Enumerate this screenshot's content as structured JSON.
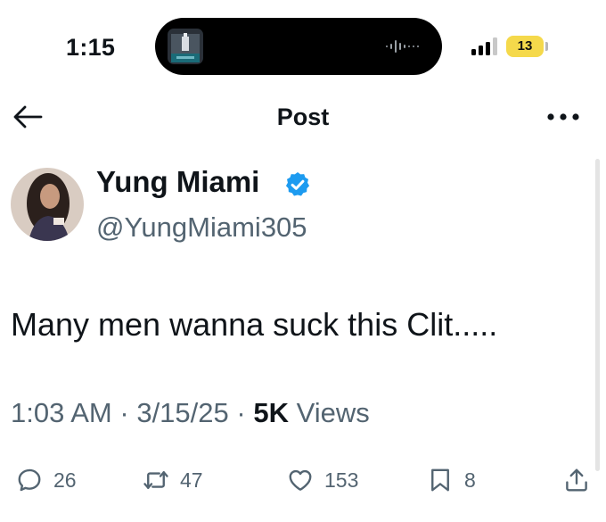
{
  "status_bar": {
    "time": "1:15",
    "battery": "13",
    "icons": [
      "now-playing-artwork",
      "audio-waveform-icon",
      "cellular-signal-icon",
      "battery-icon"
    ]
  },
  "header": {
    "title": "Post",
    "back_icon": "arrow-left-icon",
    "more_icon": "more-horizontal-icon"
  },
  "tweet": {
    "author_name": "Yung Miami",
    "author_handle": "@YungMiami305",
    "verified": true,
    "verified_color": "#1d9bf0",
    "text": "Many men wanna suck this Clit.....",
    "time": "1:03 AM",
    "date": "3/15/25",
    "separator": "·",
    "views_count": "5K",
    "views_label": "Views"
  },
  "actions": {
    "replies": "26",
    "reposts": "47",
    "likes": "153",
    "bookmarks": "8"
  },
  "colors": {
    "text_primary": "#0f1419",
    "text_secondary": "#536471",
    "accent": "#1d9bf0",
    "battery_low": "#f5d94b"
  }
}
